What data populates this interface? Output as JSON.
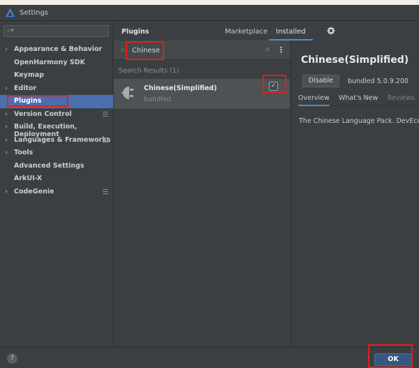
{
  "window": {
    "title": "Settings"
  },
  "sidebar": {
    "search_placeholder": "",
    "items": [
      {
        "label": "Appearance & Behavior",
        "arrow": "›",
        "badge": false
      },
      {
        "label": "OpenHarmony SDK",
        "arrow": "",
        "badge": false
      },
      {
        "label": "Keymap",
        "arrow": "",
        "badge": false
      },
      {
        "label": "Editor",
        "arrow": "›",
        "badge": false
      },
      {
        "label": "Plugins",
        "arrow": "",
        "badge": false,
        "selected": true
      },
      {
        "label": "Version Control",
        "arrow": "›",
        "badge": true
      },
      {
        "label": "Build, Execution, Deployment",
        "arrow": "›",
        "badge": false
      },
      {
        "label": "Languages & Frameworks",
        "arrow": "›",
        "badge": true
      },
      {
        "label": "Tools",
        "arrow": "›",
        "badge": false
      },
      {
        "label": "Advanced Settings",
        "arrow": "",
        "badge": false
      },
      {
        "label": "ArkUI-X",
        "arrow": "",
        "badge": false
      },
      {
        "label": "CodeGenie",
        "arrow": "›",
        "badge": true
      }
    ]
  },
  "plugins": {
    "title": "Plugins",
    "tabs": {
      "marketplace": "Marketplace",
      "installed": "Installed",
      "active": "installed"
    },
    "search_query": "Chinese",
    "clear_glyph": "×",
    "more_glyph": "⋮",
    "results_label": "Search Results (1)",
    "results": [
      {
        "name": "Chinese(Simplified)",
        "sub": "bundled",
        "enabled": true,
        "check_glyph": "✓"
      }
    ]
  },
  "detail": {
    "title": "Chinese(Simplified)",
    "disable_label": "Disable",
    "version": "bundled 5.0.9.200",
    "tabs": {
      "overview": "Overview",
      "whats_new": "What's New",
      "reviews": "Reviews"
    },
    "description": "The Chinese Language Pack. DevEco Studio"
  },
  "footer": {
    "help_glyph": "?",
    "ok_label": "OK"
  },
  "colors": {
    "selection": "#4b6eaf",
    "accent": "#4b8fd4",
    "annotation": "#e02020"
  }
}
